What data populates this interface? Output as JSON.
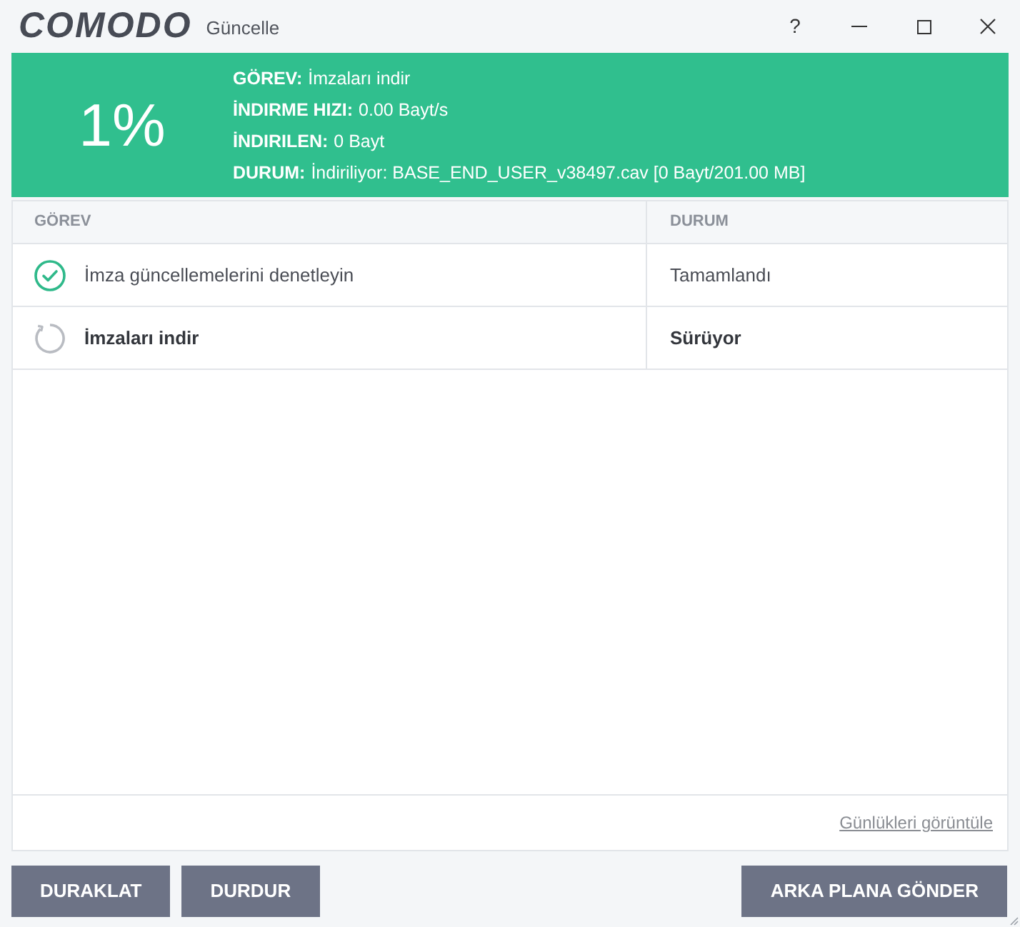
{
  "window": {
    "logo": "COMODO",
    "title": "Güncelle",
    "help": "?"
  },
  "banner": {
    "percent": "1%",
    "fields": [
      {
        "label": "GÖREV:",
        "value": "İmzaları indir"
      },
      {
        "label": "İNDIRME HIZI:",
        "value": "0.00 Bayt/s"
      },
      {
        "label": "İNDIRILEN:",
        "value": "0 Bayt"
      },
      {
        "label": "DURUM:",
        "value": "İndiriliyor: BASE_END_USER_v38497.cav [0 Bayt/201.00 MB]"
      }
    ]
  },
  "table": {
    "columns": [
      "GÖREV",
      "DURUM"
    ],
    "rows": [
      {
        "kind": "completed",
        "task": "İmza güncellemelerini denetleyin",
        "status": "Tamamlandı"
      },
      {
        "kind": "running",
        "task": "İmzaları indir",
        "status": "Sürüyor"
      }
    ]
  },
  "footer": {
    "link": "Günlükleri görüntüle"
  },
  "buttons": {
    "left": [
      "DURAKLAT",
      "DURDUR"
    ],
    "right": [
      "ARKA PLANA GÖNDER"
    ]
  }
}
